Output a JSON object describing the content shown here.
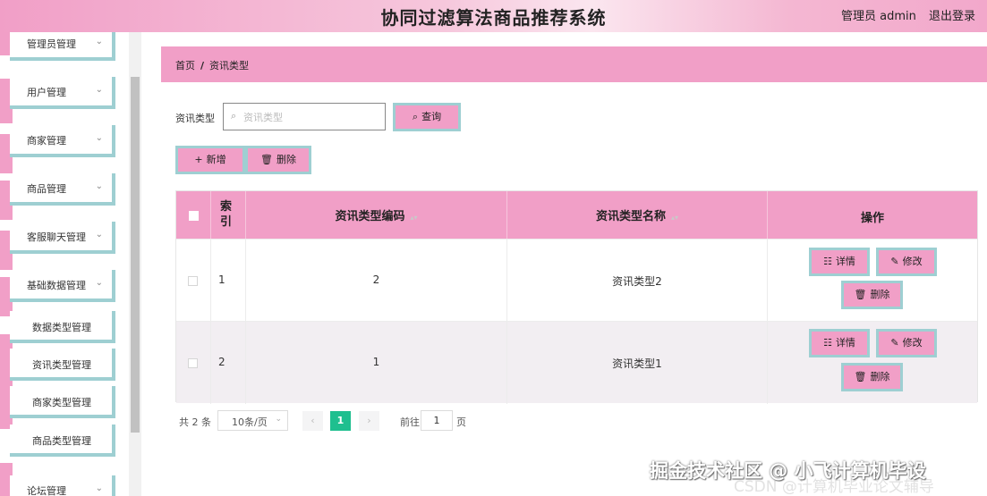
{
  "header": {
    "title": "协同过滤算法商品推荐系统",
    "admin_label": "管理员 admin",
    "logout_label": "退出登录"
  },
  "sidebar": {
    "items": [
      {
        "label": "管理员管理",
        "expanded": false
      },
      {
        "label": "用户管理",
        "expanded": false
      },
      {
        "label": "商家管理",
        "expanded": false
      },
      {
        "label": "商品管理",
        "expanded": false
      },
      {
        "label": "客服聊天管理",
        "expanded": false
      },
      {
        "label": "基础数据管理",
        "expanded": true
      },
      {
        "label": "论坛管理",
        "expanded": false
      }
    ],
    "subitems": [
      {
        "label": "数据类型管理"
      },
      {
        "label": "资讯类型管理"
      },
      {
        "label": "商家类型管理"
      },
      {
        "label": "商品类型管理"
      }
    ],
    "chevron": "⌄"
  },
  "breadcrumb": {
    "home": "首页",
    "separator": "/",
    "current": "资讯类型"
  },
  "filter": {
    "label": "资讯类型",
    "placeholder": "资讯类型",
    "search_button": "查询"
  },
  "actions": {
    "add": "新增",
    "delete": "删除"
  },
  "table": {
    "columns": [
      "索引",
      "资讯类型编码",
      "资讯类型名称",
      "操作"
    ],
    "rows": [
      {
        "index": "1",
        "code": "2",
        "name": "资讯类型2"
      },
      {
        "index": "2",
        "code": "1",
        "name": "资讯类型1"
      }
    ],
    "row_actions": {
      "detail": "详情",
      "edit": "修改",
      "delete": "删除"
    }
  },
  "pagination": {
    "total": "共 2 条",
    "page_size": "10条/页",
    "current_page": "1",
    "goto_label": "前往",
    "goto_value": "1",
    "page_unit": "页"
  },
  "watermark": {
    "line1": "掘金技术社区 @ 小飞计算机毕设",
    "line2": "CSDN @计算机毕业论文辅导"
  },
  "colors": {
    "accent_pink": "#f19fc7",
    "border_teal": "#9ecfd2",
    "pagination_active": "#1fbf8f"
  }
}
